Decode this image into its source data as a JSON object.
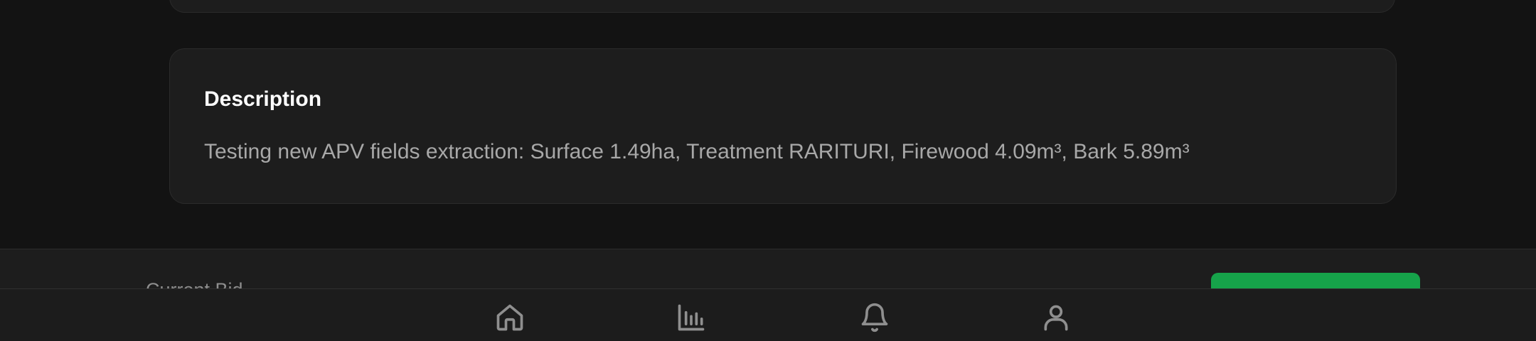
{
  "description": {
    "title": "Description",
    "text": "Testing new APV fields extraction: Surface 1.49ha, Treatment RARITURI, Firewood 4.09m³, Bark 5.89m³"
  },
  "bid_bar": {
    "label": "Current Bid"
  },
  "bottom_nav": {
    "items": [
      {
        "icon": "home-icon"
      },
      {
        "icon": "bar-chart-icon"
      },
      {
        "icon": "bell-icon"
      },
      {
        "icon": "user-icon"
      }
    ]
  },
  "colors": {
    "background": "#131313",
    "card": "#1d1d1d",
    "accent_green": "#16a34a",
    "text_primary": "#ffffff",
    "text_secondary": "#a8a8a8"
  }
}
